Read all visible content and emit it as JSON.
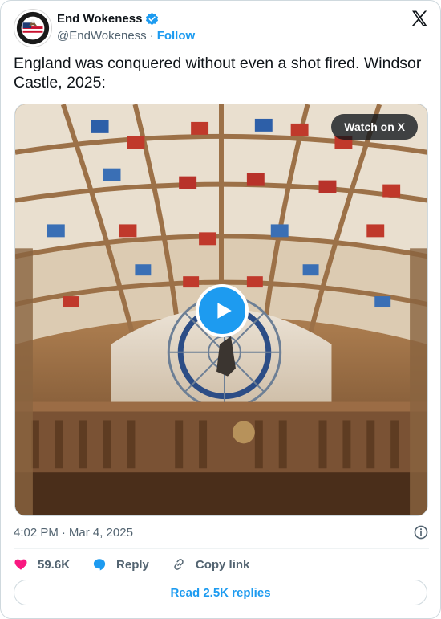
{
  "author": {
    "name": "End Wokeness",
    "handle": "@EndWokeness",
    "separator": "·",
    "follow_label": "Follow",
    "verified": true,
    "avatar_icon": "eagle-flag-badge-icon"
  },
  "tweet": {
    "text": "England was conquered without even a shot fired. Windsor Castle, 2025:"
  },
  "media": {
    "watch_label": "Watch on X",
    "play_icon": "play-icon",
    "accent_color": "#1d9bf0"
  },
  "meta": {
    "time": "4:02 PM",
    "separator": "·",
    "date": "Mar 4, 2025",
    "info_icon": "info-icon"
  },
  "actions": {
    "likes": "59.6K",
    "reply_label": "Reply",
    "copy_link_label": "Copy link"
  },
  "read_replies_label": "Read 2.5K replies",
  "colors": {
    "brand_blue": "#1d9bf0",
    "like_red": "#f91880",
    "text_primary": "#0f1419",
    "text_secondary": "#536471",
    "border": "#cfd9de"
  }
}
